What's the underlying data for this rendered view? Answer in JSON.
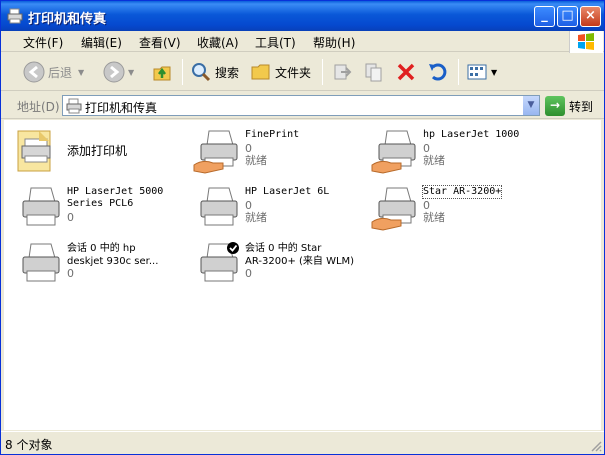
{
  "window": {
    "title": "打印机和传真"
  },
  "menu": [
    "文件(F)",
    "编辑(E)",
    "查看(V)",
    "收藏(A)",
    "工具(T)",
    "帮助(H)"
  ],
  "toolbar": {
    "back": "后退",
    "search": "搜索",
    "folders": "文件夹"
  },
  "address": {
    "label": "地址(D)",
    "value": "打印机和传真",
    "go": "转到"
  },
  "printers": [
    {
      "name": "添加打印机",
      "line2": "",
      "line3": "",
      "icon": "add-printer-icon"
    },
    {
      "name": "FinePrint",
      "line2": "0",
      "line3": "就绪",
      "icon": "shared-printer-icon"
    },
    {
      "name": "hp LaserJet 1000",
      "line2": "0",
      "line3": "就绪",
      "icon": "shared-printer-icon"
    },
    {
      "name": "HP LaserJet 5000\nSeries PCL6",
      "line2": "0",
      "line3": "",
      "icon": "printer-icon"
    },
    {
      "name": "HP LaserJet 6L",
      "line2": "0",
      "line3": "就绪",
      "icon": "printer-icon"
    },
    {
      "name": "Star AR-3200+",
      "line2": "0",
      "line3": "就绪",
      "icon": "shared-printer-icon"
    },
    {
      "name": "会话 0 中的 hp\ndeskjet 930c ser...",
      "line2": "0",
      "line3": "",
      "icon": "printer-icon"
    },
    {
      "name": "会话 0 中的 Star\nAR-3200+ (来自 WLM)",
      "line2": "0",
      "line3": "",
      "icon": "default-printer-icon"
    }
  ],
  "status": {
    "text": "8 个对象"
  },
  "colors": {
    "titlebar": "#0A58D8",
    "chrome": "#ECE9D8",
    "text_secondary": "#6E6E6E"
  }
}
